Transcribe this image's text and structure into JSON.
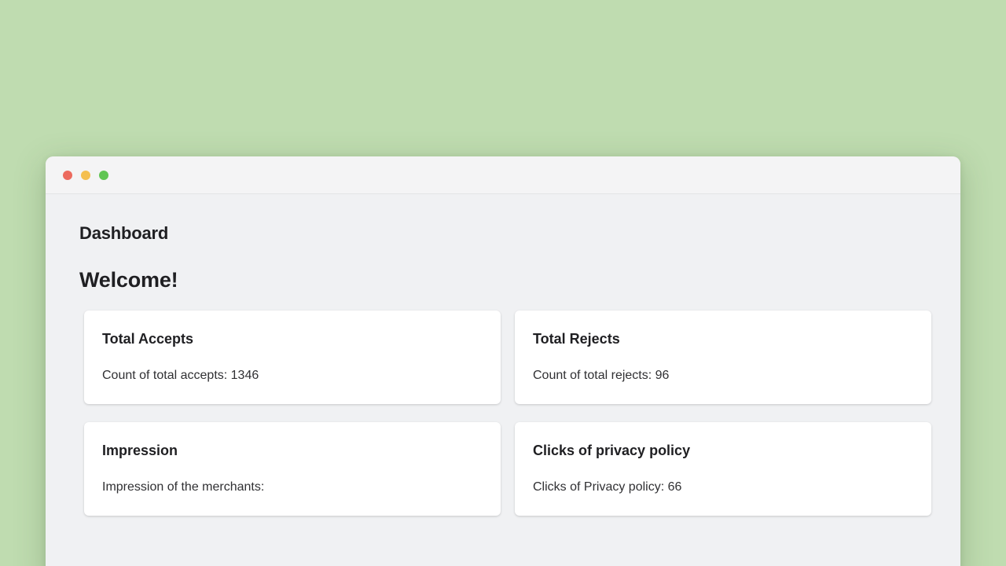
{
  "header": {
    "title": "Dashboard",
    "welcome": "Welcome!"
  },
  "cards": [
    {
      "title": "Total Accepts",
      "text": "Count of total accepts: 1346"
    },
    {
      "title": "Total Rejects",
      "text": "Count of total rejects: 96"
    },
    {
      "title": "Impression",
      "text": "Impression of the merchants:"
    },
    {
      "title": "Clicks of privacy policy",
      "text": "Clicks of Privacy policy: 66"
    }
  ],
  "colors": {
    "background": "#bfdcb0",
    "window": "#f0f1f3",
    "close": "#ec6a5e",
    "minimize": "#f4bf4f",
    "maximize": "#61c554"
  }
}
